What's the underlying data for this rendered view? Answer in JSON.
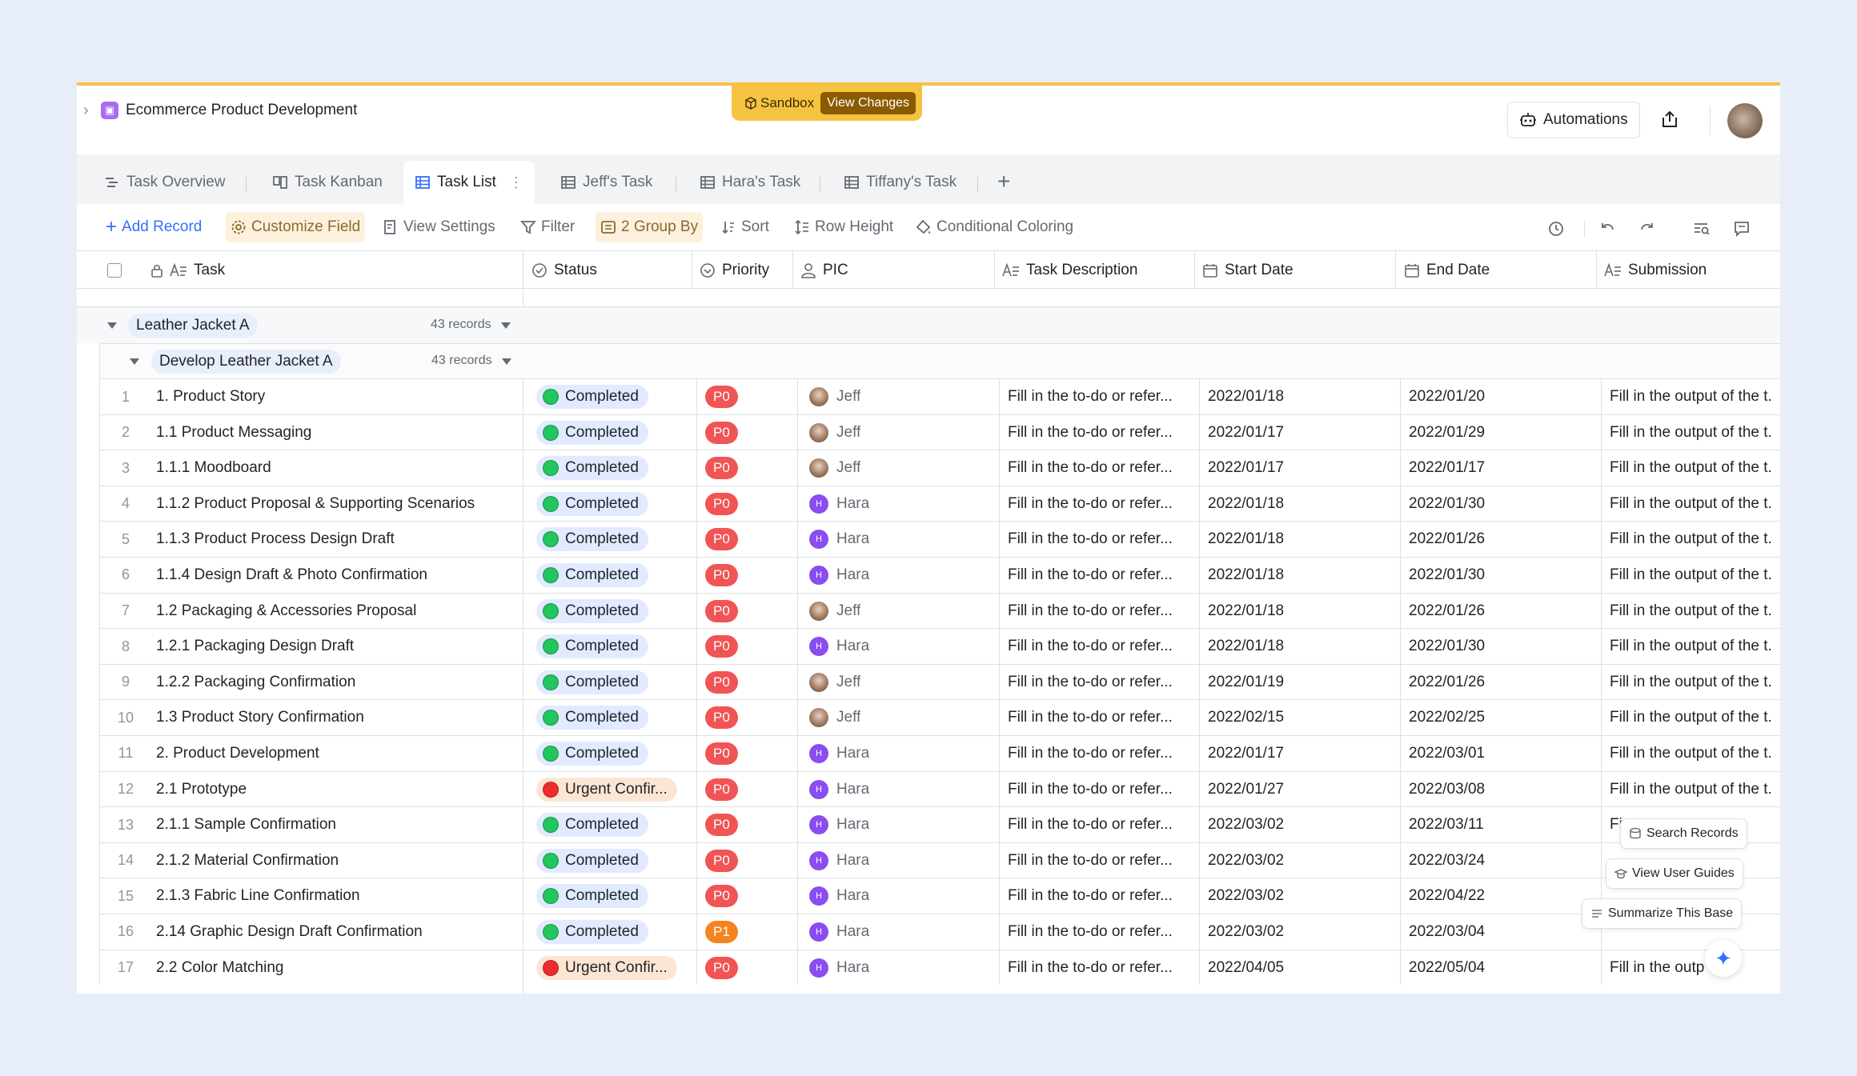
{
  "base": {
    "title": "Ecommerce Product Development"
  },
  "sandbox": {
    "label": "Sandbox",
    "view_changes": "View Changes"
  },
  "topbar": {
    "automations": "Automations"
  },
  "tabs": [
    {
      "label": "Task Overview",
      "icon": "gantt-icon"
    },
    {
      "label": "Task Kanban",
      "icon": "kanban-icon"
    },
    {
      "label": "Task List",
      "icon": "grid-icon",
      "active": true
    },
    {
      "label": "Jeff's Task",
      "icon": "grid-icon"
    },
    {
      "label": "Hara's Task",
      "icon": "grid-icon"
    },
    {
      "label": "Tiffany's Task",
      "icon": "grid-icon"
    }
  ],
  "toolbar": {
    "add_record": "Add Record",
    "customize_field": "Customize Field",
    "view_settings": "View Settings",
    "filter": "Filter",
    "group_by": "2 Group By",
    "sort": "Sort",
    "row_height": "Row Height",
    "conditional_coloring": "Conditional Coloring"
  },
  "columns": {
    "task": "Task",
    "status": "Status",
    "priority": "Priority",
    "pic": "PIC",
    "task_description": "Task Description",
    "start_date": "Start Date",
    "end_date": "End Date",
    "submission": "Submission"
  },
  "groups": {
    "level1": {
      "label": "Leather Jacket A",
      "count": "43 records"
    },
    "level2": {
      "label": "Develop Leather Jacket A",
      "count": "43 records"
    }
  },
  "rows": [
    {
      "num": "1",
      "task": "1. Product Story",
      "status": "Completed",
      "status_type": "completed",
      "priority": "P0",
      "pic": "Jeff",
      "desc": "Fill in the to-do or refer...",
      "start": "2022/01/18",
      "end": "2022/01/20",
      "submission": "Fill in the output of the t."
    },
    {
      "num": "2",
      "task": "1.1 Product Messaging",
      "status": "Completed",
      "status_type": "completed",
      "priority": "P0",
      "pic": "Jeff",
      "desc": "Fill in the to-do or refer...",
      "start": "2022/01/17",
      "end": "2022/01/29",
      "submission": "Fill in the output of the t."
    },
    {
      "num": "3",
      "task": "1.1.1 Moodboard",
      "status": "Completed",
      "status_type": "completed",
      "priority": "P0",
      "pic": "Jeff",
      "desc": "Fill in the to-do or refer...",
      "start": "2022/01/17",
      "end": "2022/01/17",
      "submission": "Fill in the output of the t."
    },
    {
      "num": "4",
      "task": "1.1.2 Product Proposal & Supporting Scenarios",
      "status": "Completed",
      "status_type": "completed",
      "priority": "P0",
      "pic": "Hara",
      "desc": "Fill in the to-do or refer...",
      "start": "2022/01/18",
      "end": "2022/01/30",
      "submission": "Fill in the output of the t."
    },
    {
      "num": "5",
      "task": "1.1.3 Product Process Design Draft",
      "status": "Completed",
      "status_type": "completed",
      "priority": "P0",
      "pic": "Hara",
      "desc": "Fill in the to-do or refer...",
      "start": "2022/01/18",
      "end": "2022/01/26",
      "submission": "Fill in the output of the t."
    },
    {
      "num": "6",
      "task": "1.1.4 Design Draft & Photo Confirmation",
      "status": "Completed",
      "status_type": "completed",
      "priority": "P0",
      "pic": "Hara",
      "desc": "Fill in the to-do or refer...",
      "start": "2022/01/18",
      "end": "2022/01/30",
      "submission": "Fill in the output of the t."
    },
    {
      "num": "7",
      "task": "1.2 Packaging & Accessories Proposal",
      "status": "Completed",
      "status_type": "completed",
      "priority": "P0",
      "pic": "Jeff",
      "desc": "Fill in the to-do or refer...",
      "start": "2022/01/18",
      "end": "2022/01/26",
      "submission": "Fill in the output of the t."
    },
    {
      "num": "8",
      "task": "1.2.1 Packaging Design Draft",
      "status": "Completed",
      "status_type": "completed",
      "priority": "P0",
      "pic": "Hara",
      "desc": "Fill in the to-do or refer...",
      "start": "2022/01/18",
      "end": "2022/01/30",
      "submission": "Fill in the output of the t."
    },
    {
      "num": "9",
      "task": "1.2.2 Packaging Confirmation",
      "status": "Completed",
      "status_type": "completed",
      "priority": "P0",
      "pic": "Jeff",
      "desc": "Fill in the to-do or refer...",
      "start": "2022/01/19",
      "end": "2022/01/26",
      "submission": "Fill in the output of the t."
    },
    {
      "num": "10",
      "task": "1.3 Product Story Confirmation",
      "status": "Completed",
      "status_type": "completed",
      "priority": "P0",
      "pic": "Jeff",
      "desc": "Fill in the to-do or refer...",
      "start": "2022/02/15",
      "end": "2022/02/25",
      "submission": "Fill in the output of the t."
    },
    {
      "num": "11",
      "task": "2. Product Development",
      "status": "Completed",
      "status_type": "completed",
      "priority": "P0",
      "pic": "Hara",
      "desc": "Fill in the to-do or refer...",
      "start": "2022/01/17",
      "end": "2022/03/01",
      "submission": "Fill in the output of the t."
    },
    {
      "num": "12",
      "task": "2.1 Prototype",
      "status": "Urgent Confir...",
      "status_type": "urgent",
      "priority": "P0",
      "pic": "Hara",
      "desc": "Fill in the to-do or refer...",
      "start": "2022/01/27",
      "end": "2022/03/08",
      "submission": "Fill in the output of the t."
    },
    {
      "num": "13",
      "task": "2.1.1 Sample Confirmation",
      "status": "Completed",
      "status_type": "completed",
      "priority": "P0",
      "pic": "Hara",
      "desc": "Fill in the to-do or refer...",
      "start": "2022/03/02",
      "end": "2022/03/11",
      "submission": "Fi"
    },
    {
      "num": "14",
      "task": "2.1.2 Material Confirmation",
      "status": "Completed",
      "status_type": "completed",
      "priority": "P0",
      "pic": "Hara",
      "desc": "Fill in the to-do or refer...",
      "start": "2022/03/02",
      "end": "2022/03/24",
      "submission": ""
    },
    {
      "num": "15",
      "task": "2.1.3 Fabric Line Confirmation",
      "status": "Completed",
      "status_type": "completed",
      "priority": "P0",
      "pic": "Hara",
      "desc": "Fill in the to-do or refer...",
      "start": "2022/03/02",
      "end": "2022/04/22",
      "submission": ""
    },
    {
      "num": "16",
      "task": "2.14 Graphic Design Draft Confirmation",
      "status": "Completed",
      "status_type": "completed",
      "priority": "P1",
      "pic": "Hara",
      "desc": "Fill in the to-do or refer...",
      "start": "2022/03/02",
      "end": "2022/03/04",
      "submission": ""
    },
    {
      "num": "17",
      "task": "2.2 Color Matching",
      "status": "Urgent Confir...",
      "status_type": "urgent",
      "priority": "P0",
      "pic": "Hara",
      "desc": "Fill in the to-do or refer...",
      "start": "2022/04/05",
      "end": "2022/05/04",
      "submission": "Fill in the outp"
    }
  ],
  "float_menu": {
    "search_records": "Search Records",
    "view_user_guides": "View User Guides",
    "summarize_base": "Summarize This Base"
  },
  "colors": {
    "status_completed": "#22c55e",
    "status_urgent": "#ef2b2b",
    "priority_p0": "#f05454",
    "priority_p1": "#f5831f",
    "accent": "#3370ff",
    "sandbox": "#f5c242"
  }
}
